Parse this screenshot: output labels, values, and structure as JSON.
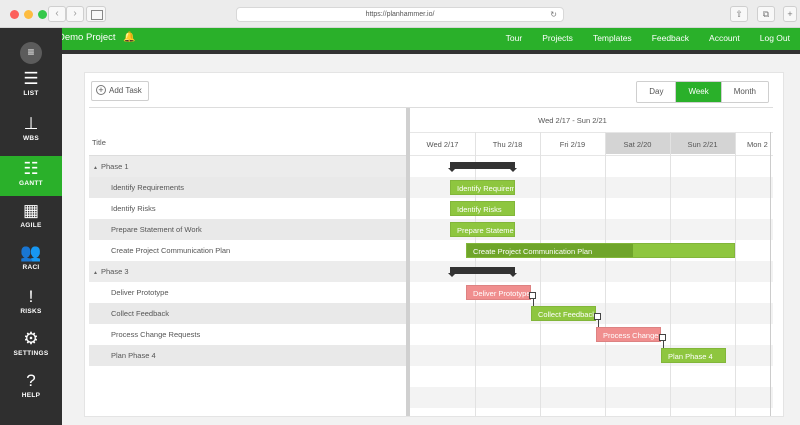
{
  "browser": {
    "url": "https://planhammer.io/"
  },
  "header": {
    "project_name": "Demo Project",
    "nav": [
      "Tour",
      "Projects",
      "Templates",
      "Feedback",
      "Account",
      "Log Out"
    ]
  },
  "sidebar": {
    "items": [
      {
        "label": "LIST",
        "icon": "list-icon"
      },
      {
        "label": "WBS",
        "icon": "wbs-icon"
      },
      {
        "label": "GANTT",
        "icon": "gantt-icon",
        "active": true
      },
      {
        "label": "AGILE",
        "icon": "agile-icon"
      },
      {
        "label": "RACI",
        "icon": "raci-icon"
      },
      {
        "label": "RISKS",
        "icon": "risks-icon"
      },
      {
        "label": "SETTINGS",
        "icon": "gear-icon"
      },
      {
        "label": "HELP",
        "icon": "help-icon"
      }
    ]
  },
  "toolbar": {
    "add_task_label": "Add Task",
    "views": [
      "Day",
      "Week",
      "Month"
    ],
    "active_view": "Week"
  },
  "tree": {
    "title_header": "Title",
    "rows": [
      {
        "label": "Phase 1",
        "type": "phase"
      },
      {
        "label": "Identify Requirements",
        "type": "task"
      },
      {
        "label": "Identify Risks",
        "type": "task"
      },
      {
        "label": "Prepare Statement of Work",
        "type": "task"
      },
      {
        "label": "Create Project Communication Plan",
        "type": "task"
      },
      {
        "label": "Phase 3",
        "type": "phase"
      },
      {
        "label": "Deliver Prototype",
        "type": "task"
      },
      {
        "label": "Collect Feedback",
        "type": "task"
      },
      {
        "label": "Process Change Requests",
        "type": "task"
      },
      {
        "label": "Plan Phase 4",
        "type": "task"
      }
    ]
  },
  "chart": {
    "week_range": "Wed 2/17 - Sun 2/21",
    "days": [
      "Wed 2/17",
      "Thu 2/18",
      "Fri 2/19",
      "Sat 2/20",
      "Sun 2/21",
      "Mon 2"
    ],
    "bars": [
      {
        "label": "Identify Requirements",
        "color": "#8ec63f"
      },
      {
        "label": "Identify Risks",
        "color": "#8ec63f"
      },
      {
        "label": "Prepare Statement of Work",
        "color": "#8ec63f"
      },
      {
        "label": "Create Project Communication Plan",
        "color": "#8ec63f",
        "progress": 0.62
      },
      {
        "label": "Deliver Prototype",
        "color": "#f08e8e"
      },
      {
        "label": "Collect Feedback",
        "color": "#8ec63f"
      },
      {
        "label": "Process Change Requests",
        "color": "#f08e8e"
      },
      {
        "label": "Plan Phase 4",
        "color": "#8ec63f"
      }
    ]
  }
}
